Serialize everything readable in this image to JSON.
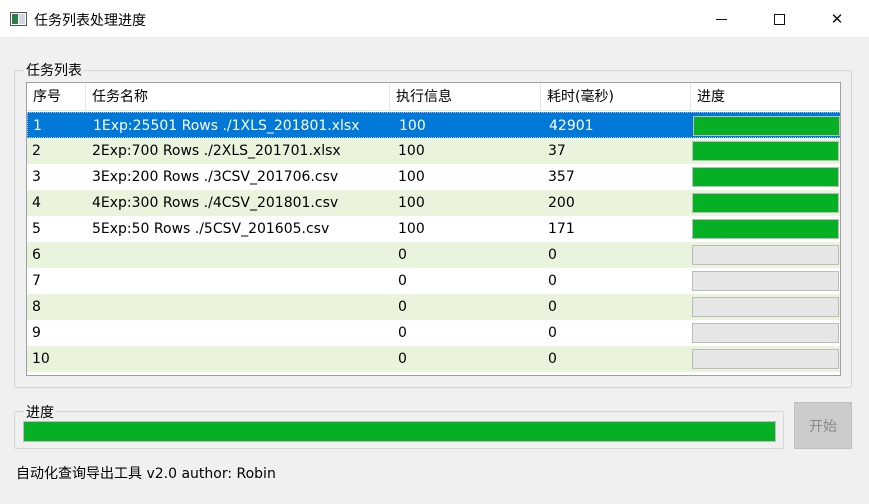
{
  "window": {
    "title": "任务列表处理进度",
    "minimize_glyph": "",
    "close_glyph": "✕"
  },
  "tasks_group": {
    "title": "任务列表",
    "columns": [
      "序号",
      "任务名称",
      "执行信息",
      "耗时(毫秒)",
      "进度"
    ],
    "rows": [
      {
        "id": "1",
        "name": "1Exp:25501 Rows ./1XLS_201801.xlsx",
        "info": "100",
        "time": "42901",
        "progress": 1,
        "selected": true
      },
      {
        "id": "2",
        "name": "2Exp:700 Rows ./2XLS_201701.xlsx",
        "info": "100",
        "time": "37",
        "progress": 1
      },
      {
        "id": "3",
        "name": "3Exp:200 Rows ./3CSV_201706.csv",
        "info": "100",
        "time": "357",
        "progress": 1
      },
      {
        "id": "4",
        "name": "4Exp:300 Rows ./4CSV_201801.csv",
        "info": "100",
        "time": "200",
        "progress": 1
      },
      {
        "id": "5",
        "name": "5Exp:50 Rows ./5CSV_201605.csv",
        "info": "100",
        "time": "171",
        "progress": 1
      },
      {
        "id": "6",
        "name": "",
        "info": "0",
        "time": "0",
        "progress": 0
      },
      {
        "id": "7",
        "name": "",
        "info": "0",
        "time": "0",
        "progress": 0
      },
      {
        "id": "8",
        "name": "",
        "info": "0",
        "time": "0",
        "progress": 0
      },
      {
        "id": "9",
        "name": "",
        "info": "0",
        "time": "0",
        "progress": 0
      },
      {
        "id": "10",
        "name": "",
        "info": "0",
        "time": "0",
        "progress": 0
      }
    ]
  },
  "progress_group": {
    "title": "进度",
    "overall_progress": 1
  },
  "start_button": "开始",
  "footer": "自动化查询导出工具 v2.0  author: Robin",
  "colors": {
    "progress_green": "#06b025",
    "selection_blue": "#0078d7",
    "alt_row": "#eaf3dc"
  }
}
